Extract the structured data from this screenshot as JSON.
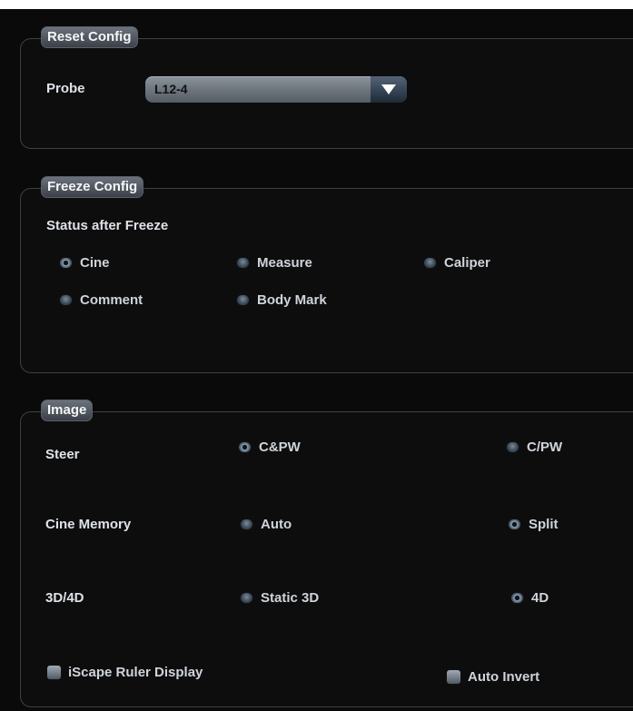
{
  "reset_config": {
    "legend": "Reset Config",
    "probe_label": "Probe",
    "probe_value": "L12-4"
  },
  "freeze_config": {
    "legend": "Freeze Config",
    "status_label": "Status after Freeze",
    "options": [
      "Cine",
      "Measure",
      "Caliper",
      "Comment",
      "Body Mark"
    ],
    "selected": "Cine"
  },
  "image": {
    "legend": "Image",
    "steer_label": "Steer",
    "steer_options": [
      "C&PW",
      "C/PW"
    ],
    "steer_selected": "C&PW",
    "cine_memory_label": "Cine Memory",
    "cine_memory_options": [
      "Auto",
      "Split"
    ],
    "cine_memory_selected": "Split",
    "threed_label": "3D/4D",
    "threed_options": [
      "Static 3D",
      "4D"
    ],
    "threed_selected": "4D",
    "iscape_ruler_label": "iScape Ruler Display",
    "iscape_ruler_checked": false,
    "auto_invert_label": "Auto Invert",
    "auto_invert_checked": false
  }
}
